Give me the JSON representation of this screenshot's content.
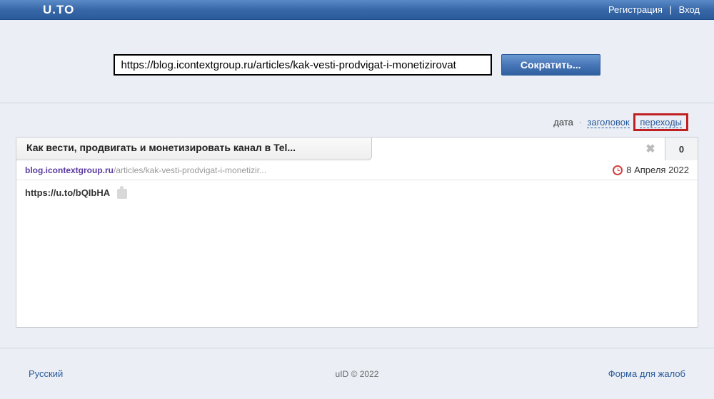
{
  "header": {
    "logo": "U.TO",
    "register": "Регистрация",
    "login": "Вход"
  },
  "shorten": {
    "url_value": "https://blog.icontextgroup.ru/articles/kak-vesti-prodvigat-i-monetizirovat",
    "button": "Сократить..."
  },
  "sort": {
    "date": "дата",
    "title": "заголовок",
    "clicks": "переходы"
  },
  "item": {
    "title": "Как вести, продвигать и монетизировать канал в Tel...",
    "domain": "blog.icontextgroup.ru",
    "path": "/articles/kak-vesti-prodvigat-i-monetizir...",
    "date": "8 Апреля 2022",
    "short_url": "https://u.to/bQIbHA",
    "count": "0"
  },
  "footer": {
    "language": "Русский",
    "copyright": "uID © 2022",
    "complaint": "Форма для жалоб"
  }
}
